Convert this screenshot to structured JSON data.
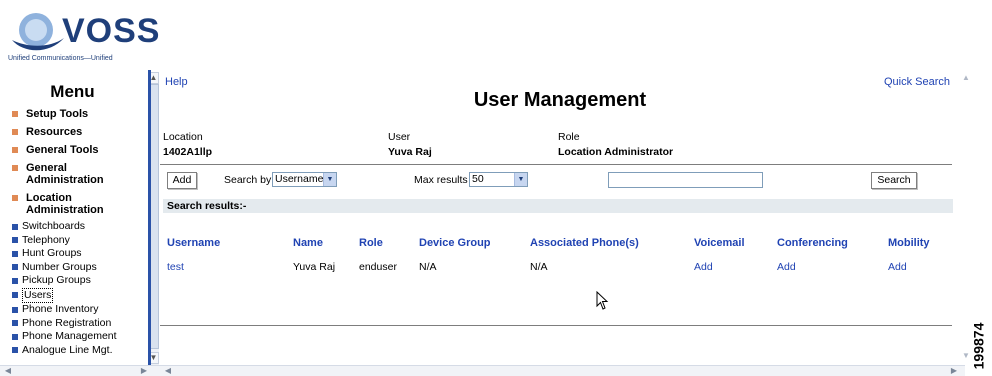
{
  "logo": {
    "word": "VOSS",
    "tagline": "Unified Communications—Unified"
  },
  "menu": {
    "title": "Menu",
    "items": [
      {
        "label": "Setup Tools"
      },
      {
        "label": "Resources"
      },
      {
        "label": "General Tools"
      },
      {
        "label": "General Administration"
      },
      {
        "label": "Location Administration"
      }
    ],
    "subitems": [
      {
        "label": "Switchboards"
      },
      {
        "label": "Telephony"
      },
      {
        "label": "Hunt Groups"
      },
      {
        "label": "Number Groups"
      },
      {
        "label": "Pickup Groups"
      },
      {
        "label": "Users"
      },
      {
        "label": "Phone Inventory"
      },
      {
        "label": "Phone Registration"
      },
      {
        "label": "Phone Management"
      },
      {
        "label": "Analogue Line Mgt."
      }
    ]
  },
  "header": {
    "help": "Help",
    "quick_search": "Quick Search",
    "title": "User Management"
  },
  "context": {
    "location_label": "Location",
    "location_value": "1402A1llp",
    "user_label": "User",
    "user_value": "Yuva Raj",
    "role_label": "Role",
    "role_value": "Location Administrator"
  },
  "toolbar": {
    "add_label": "Add",
    "search_by_label": "Search by",
    "search_by_value": "Username",
    "max_results_label": "Max results",
    "max_results_value": "50",
    "search_input_value": "",
    "search_label": "Search"
  },
  "results": {
    "heading": "Search results:-",
    "columns": [
      "Username",
      "Name",
      "Role",
      "Device Group",
      "Associated Phone(s)",
      "Voicemail",
      "Conferencing",
      "Mobility"
    ],
    "rows": [
      {
        "username": "test",
        "name": "Yuva Raj",
        "role": "enduser",
        "device_group": "N/A",
        "phones": "N/A",
        "voicemail": "Add",
        "conferencing": "Add",
        "mobility": "Add"
      }
    ]
  },
  "figure_id": "199874",
  "colors": {
    "link": "#2043b3",
    "menu_bullet": "#e08a55",
    "submenu_bullet": "#2a52a8",
    "divider": "#2a52a8"
  }
}
